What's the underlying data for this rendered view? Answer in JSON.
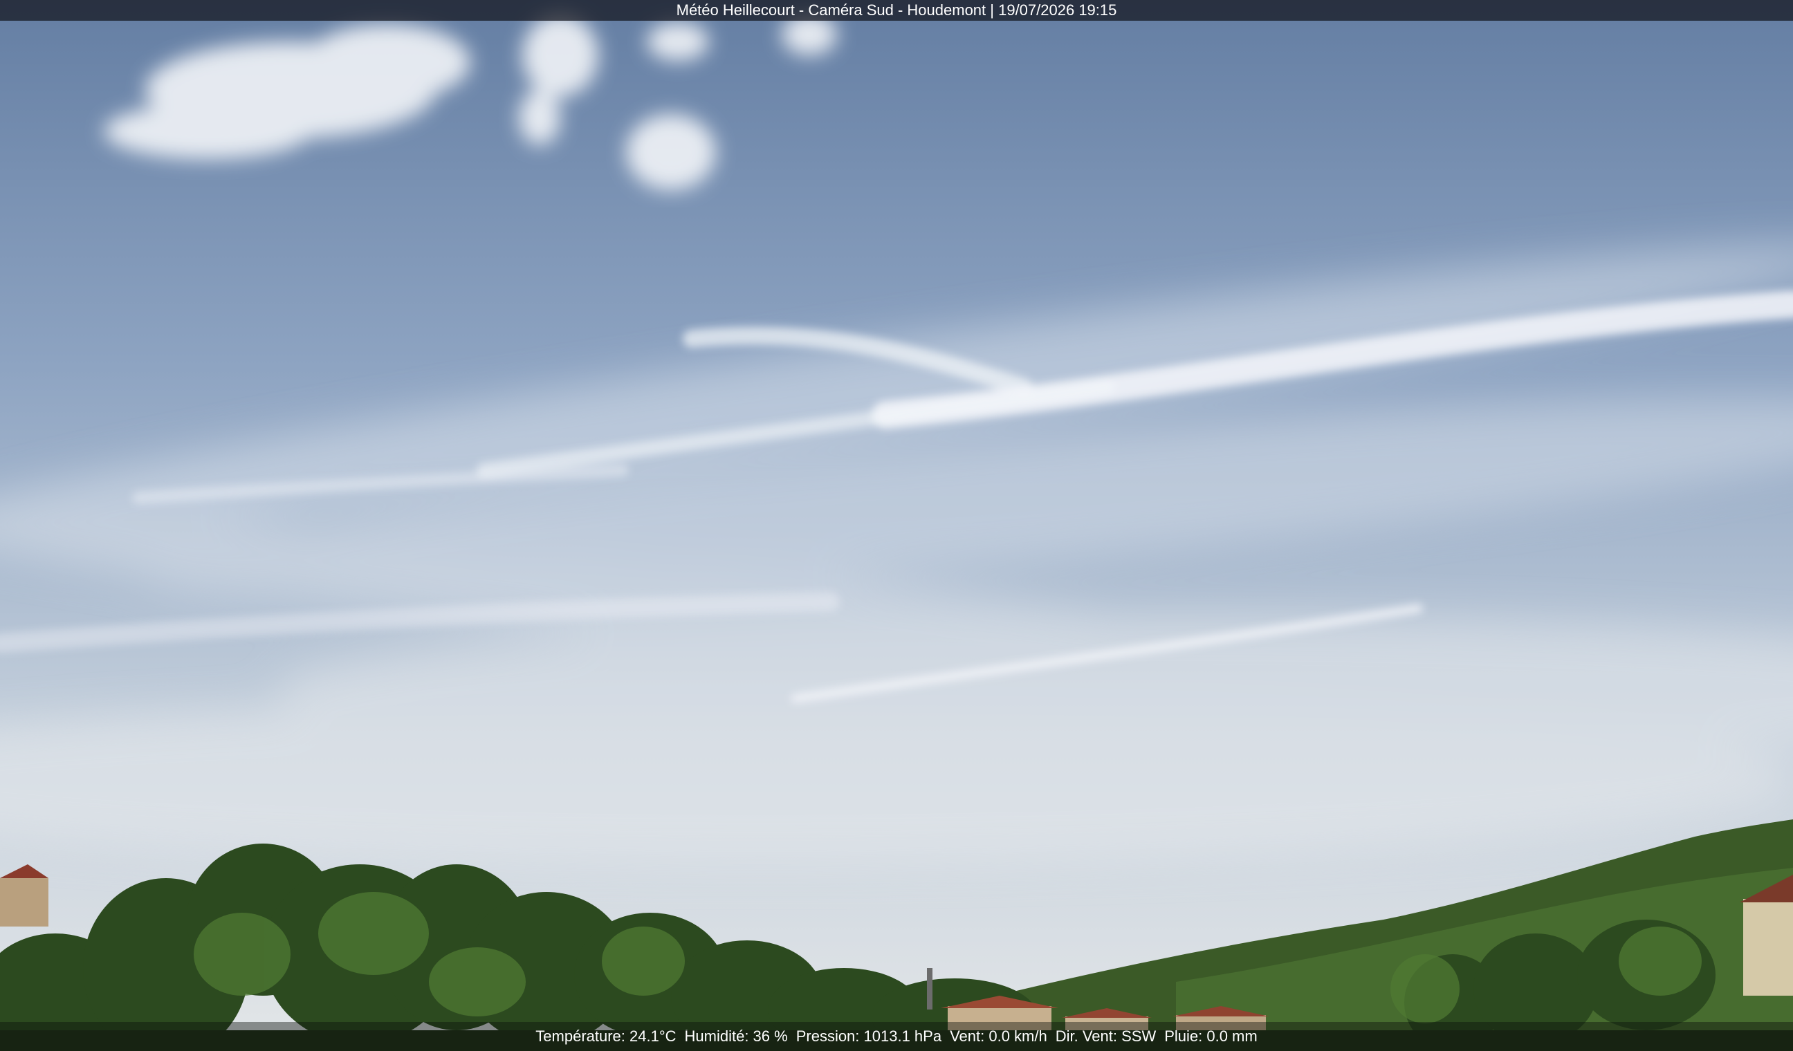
{
  "camera": {
    "title": "Météo Heillecourt - Caméra Sud - Houdemont | 19/07/2026 19:15"
  },
  "weather": {
    "temperature": "Température: 24.1°C",
    "humidity": "Humidité: 36 %",
    "pressure": "Pression: 1013.1 hPa",
    "wind_speed": "Vent: 0.0 km/h",
    "wind_dir": "Dir. Vent: SSW",
    "rain": "Pluie: 0.0 mm"
  },
  "colors": {
    "sky_top": "#6e86a8",
    "sky_mid": "#9fb4cc",
    "sky_horizon": "#d9dfe6",
    "cloud": "#f4f6f9",
    "trees_dark": "#1f3417",
    "trees_light": "#4f7a33",
    "roof": "#9a4a34"
  }
}
